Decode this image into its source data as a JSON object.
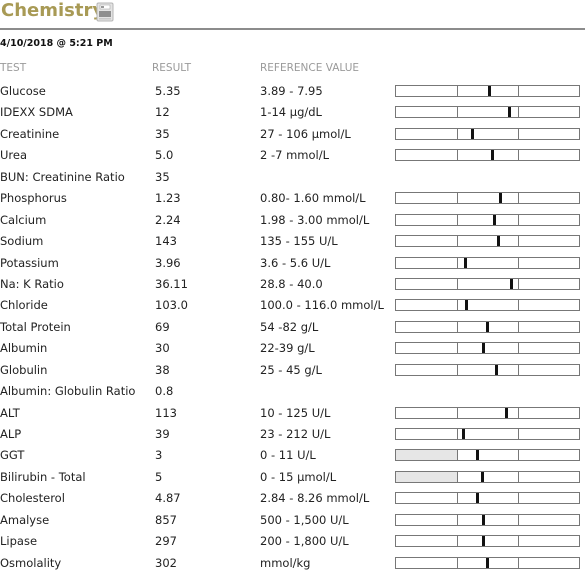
{
  "header": {
    "title": "Chemistry",
    "icon": "lab-analyzer-icon",
    "accent_color": "#a89a55"
  },
  "timestamp": "4/10/2018 @ 5:21 PM",
  "columns": {
    "test": "TEST",
    "result": "RESULT",
    "reference": "REFERENCE VALUE"
  },
  "rows": [
    {
      "test": "Glucose",
      "result": "5.35",
      "reference": "3.89 - 7.95",
      "has_bar": true,
      "marker_pos": 0.508,
      "low_shaded": false
    },
    {
      "test": "IDEXX SDMA",
      "result": "12",
      "reference": "1-14 µg/dL",
      "has_bar": true,
      "marker_pos": 0.616,
      "low_shaded": false
    },
    {
      "test": "Creatinine",
      "result": "35",
      "reference": "27 - 106 µmol/L",
      "has_bar": true,
      "marker_pos": 0.416,
      "low_shaded": false
    },
    {
      "test": "Urea",
      "result": "5.0",
      "reference": "2 -7 mmol/L",
      "has_bar": true,
      "marker_pos": 0.524,
      "low_shaded": false
    },
    {
      "test": "BUN: Creatinine Ratio",
      "result": "35",
      "reference": "",
      "has_bar": false
    },
    {
      "test": "Phosphorus",
      "result": "1.23",
      "reference": "0.80- 1.60 mmol/L",
      "has_bar": true,
      "marker_pos": 0.568,
      "low_shaded": false
    },
    {
      "test": "Calcium",
      "result": "2.24",
      "reference": "1.98 - 3.00 mmol/L",
      "has_bar": true,
      "marker_pos": 0.535,
      "low_shaded": false
    },
    {
      "test": "Sodium",
      "result": "143",
      "reference": "135 - 155 U/L",
      "has_bar": true,
      "marker_pos": 0.557,
      "low_shaded": false
    },
    {
      "test": "Potassium",
      "result": "3.96",
      "reference": "3.6 - 5.6 U/L",
      "has_bar": true,
      "marker_pos": 0.378,
      "low_shaded": false
    },
    {
      "test": "Na: K Ratio",
      "result": "36.11",
      "reference": "28.8 - 40.0",
      "has_bar": true,
      "marker_pos": 0.627,
      "low_shaded": false
    },
    {
      "test": "Chloride",
      "result": "103.0",
      "reference": "100.0 - 116.0 mmol/L",
      "has_bar": true,
      "marker_pos": 0.384,
      "low_shaded": false
    },
    {
      "test": "Total Protein",
      "result": "69",
      "reference": "54  -82 g/L",
      "has_bar": true,
      "marker_pos": 0.497,
      "low_shaded": false
    },
    {
      "test": "Albumin",
      "result": "30",
      "reference": "22-39 g/L",
      "has_bar": true,
      "marker_pos": 0.476,
      "low_shaded": false
    },
    {
      "test": "Globulin",
      "result": "38",
      "reference": "25 - 45 g/L",
      "has_bar": true,
      "marker_pos": 0.546,
      "low_shaded": false
    },
    {
      "test": "Albumin: Globulin Ratio",
      "result": "0.8",
      "reference": "",
      "has_bar": false
    },
    {
      "test": "ALT",
      "result": "113",
      "reference": "10 - 125 U/L",
      "has_bar": true,
      "marker_pos": 0.6,
      "low_shaded": false
    },
    {
      "test": "ALP",
      "result": "39",
      "reference": "23 - 212 U/L",
      "has_bar": true,
      "marker_pos": 0.368,
      "low_shaded": false
    },
    {
      "test": "GGT",
      "result": "3",
      "reference": "0 - 11 U/L",
      "has_bar": true,
      "marker_pos": 0.443,
      "low_shaded": true
    },
    {
      "test": "Bilirubin - Total",
      "result": "5",
      "reference": "0 - 15 µmol/L",
      "has_bar": true,
      "marker_pos": 0.47,
      "low_shaded": true
    },
    {
      "test": "Cholesterol",
      "result": "4.87",
      "reference": "2.84 - 8.26 mmol/L",
      "has_bar": true,
      "marker_pos": 0.443,
      "low_shaded": false
    },
    {
      "test": "Amalyse",
      "result": "857",
      "reference": "500 - 1,500 U/L",
      "has_bar": true,
      "marker_pos": 0.476,
      "low_shaded": false
    },
    {
      "test": "Lipase",
      "result": "297",
      "reference": "200 - 1,800 U/L",
      "has_bar": true,
      "marker_pos": 0.478,
      "low_shaded": false
    },
    {
      "test": "Osmolality",
      "result": "302",
      "reference": "mmol/kg",
      "has_bar": true,
      "marker_pos": 0.497,
      "low_shaded": false
    }
  ]
}
